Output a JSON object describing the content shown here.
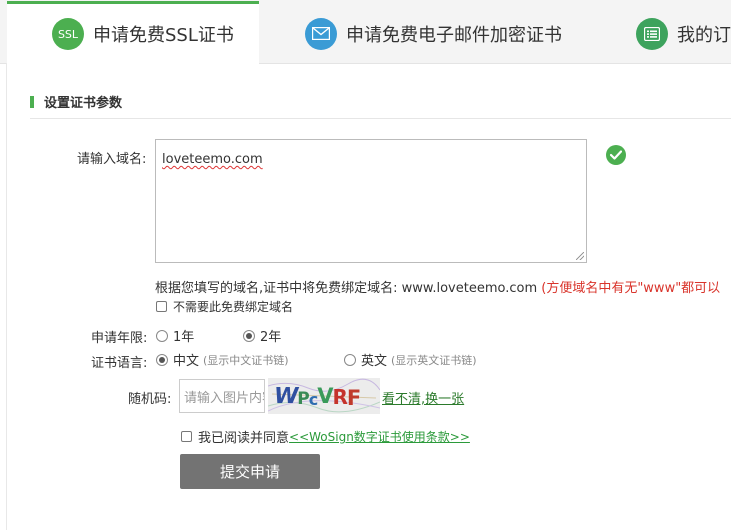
{
  "tabs": [
    {
      "label": "申请免费SSL证书",
      "icon": "ssl-icon",
      "icon_text": "SSL",
      "color": "#4caf50",
      "active": true
    },
    {
      "label": "申请免费电子邮件加密证书",
      "icon": "mail-icon",
      "color": "#3a9bd5",
      "active": false
    },
    {
      "label": "我的订单",
      "icon": "list-icon",
      "color": "#3da35d",
      "active": false
    }
  ],
  "section": {
    "title": "设置证书参数",
    "accent": "#4caf50"
  },
  "domain": {
    "label": "请输入域名:",
    "value": "loveteemo.com"
  },
  "note": {
    "text": "根据您填写的域名,证书中将免费绑定域名: www.loveteemo.com ",
    "red": "(方便域名中有无\"www\"都可以"
  },
  "no_bind": {
    "label": "不需要此免费绑定域名"
  },
  "years": {
    "label": "申请年限:",
    "options": [
      "1年",
      "2年"
    ],
    "selected": "2年"
  },
  "language": {
    "label": "证书语言:",
    "options": [
      {
        "text": "中文",
        "hint": "(显示中文证书链)"
      },
      {
        "text": "英文",
        "hint": "(显示英文证书链)"
      }
    ],
    "selected": "中文"
  },
  "captcha": {
    "label": "随机码:",
    "placeholder": "请输入图片内容",
    "image_text": "WPcVRF",
    "link": "看不清,换一张"
  },
  "agree": {
    "text": "我已阅读并同意",
    "link": "<<WoSign数字证书使用条款>>"
  },
  "submit": {
    "label": "提交申请"
  }
}
